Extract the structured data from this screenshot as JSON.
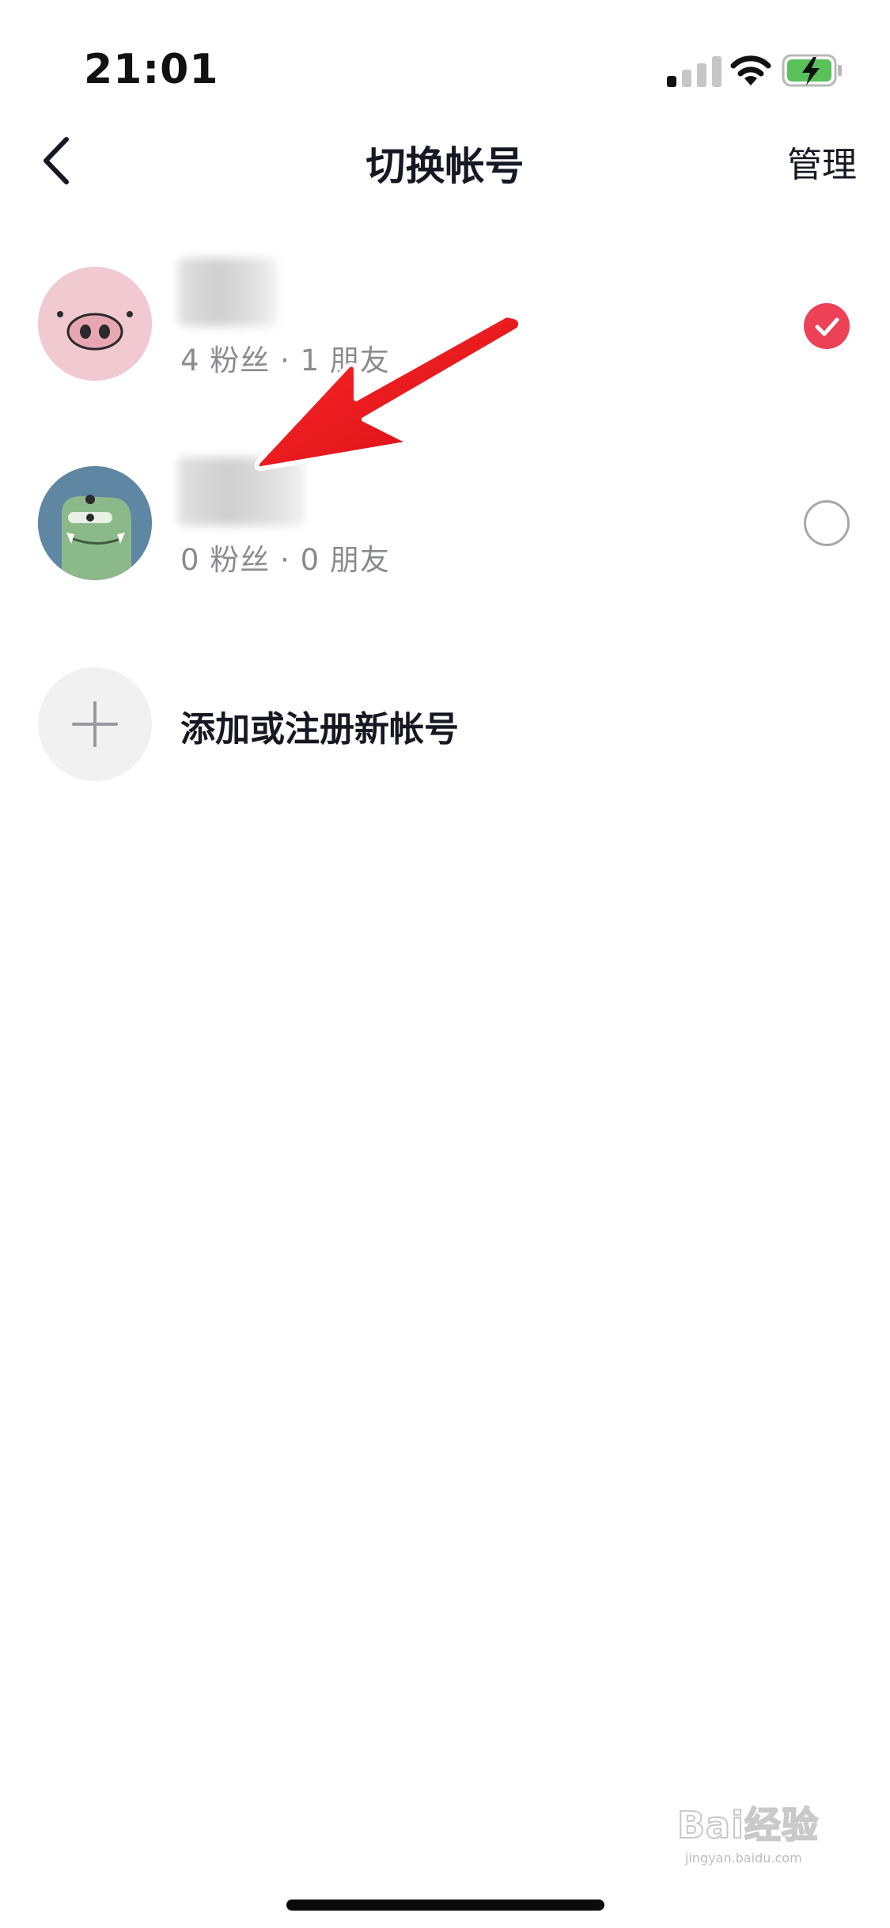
{
  "status_bar": {
    "time": "21:01",
    "signal_icon": "cellular-signal-icon",
    "wifi_icon": "wifi-icon",
    "battery_icon": "battery-charging-icon",
    "battery_color": "#5ac15a"
  },
  "header": {
    "back_icon": "chevron-left-icon",
    "title": "切换帐号",
    "manage_label": "管理"
  },
  "accounts": [
    {
      "avatar_icon": "pig-face-avatar",
      "stats": "4 粉丝 · 1 朋友",
      "selected": true
    },
    {
      "avatar_icon": "green-monster-avatar",
      "stats": "0 粉丝 · 0 朋友",
      "selected": false
    }
  ],
  "add_account": {
    "icon": "plus-icon",
    "label": "添加或注册新帐号"
  },
  "annotation": {
    "arrow_icon": "red-arrow-annotation",
    "color": "#e8141b"
  },
  "watermark": {
    "logo": "Bai经验",
    "url": "jingyan.baidu.com"
  },
  "colors": {
    "accent": "#ec4156",
    "text_primary": "#161823",
    "text_secondary": "#8a8b91"
  }
}
